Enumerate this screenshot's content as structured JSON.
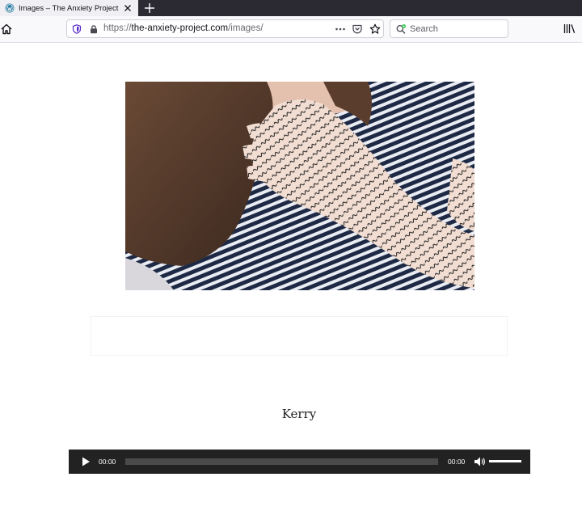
{
  "browser": {
    "tab": {
      "title": "Images – The Anxiety Project",
      "icon": "wordpress-icon"
    },
    "url": {
      "scheme": "https://",
      "host": "the-anxiety-project.com",
      "path": "/images/"
    },
    "search": {
      "placeholder": "Search"
    }
  },
  "page": {
    "caption": "Kerry",
    "image_alt": "hand covered in handwritten text"
  },
  "player": {
    "current_time": "00:00",
    "duration": "00:00",
    "progress": 0,
    "volume": 1.0
  },
  "colors": {
    "tabbar_bg": "#2b2a33",
    "player_bg": "#222222",
    "track": "#4a4a4a",
    "shield": "#5a2fc9",
    "search_green": "#2ac84a"
  }
}
